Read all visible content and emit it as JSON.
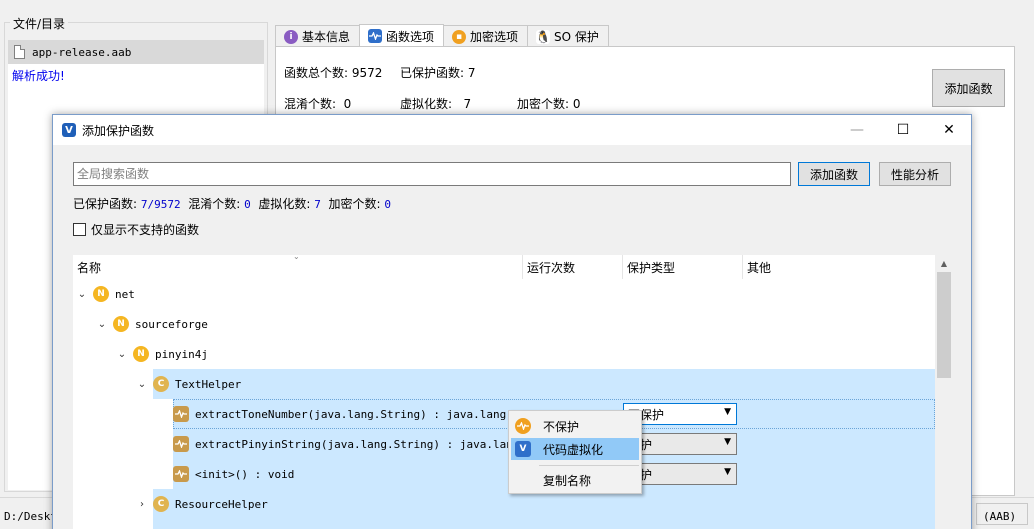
{
  "files": {
    "group_title": "文件/目录",
    "file_name": "app-release.aab",
    "parse_message": "解析成功!"
  },
  "tabs": [
    {
      "label": "基本信息",
      "icon": "info-icon"
    },
    {
      "label": "函数选项",
      "icon": "function-icon"
    },
    {
      "label": "加密选项",
      "icon": "lock-icon"
    },
    {
      "label": "SO 保护",
      "icon": "linux-icon"
    }
  ],
  "panel": {
    "total_label": "函数总个数: 9572",
    "protected_label": "已保护函数: 7",
    "obf_label": "混淆个数:  0",
    "virt_label": "虚拟化数:   7",
    "enc_label": "加密个数: 0",
    "add_button": "添加函数"
  },
  "status": {
    "left": "D:/Deskt",
    "right": "(AAB)"
  },
  "dialog": {
    "title": "添加保护函数",
    "search_placeholder": "全局搜索函数",
    "add_button": "添加函数",
    "perf_button": "性能分析",
    "stats": {
      "protected_label": "已保护函数: ",
      "protected_value": "7/9572",
      "obf_label": "  混淆个数: ",
      "obf_value": "0",
      "virt_label": "  虚拟化数: ",
      "virt_value": "7",
      "enc_label": "  加密个数: ",
      "enc_value": "0"
    },
    "only_unsupported": "仅显示不支持的函数",
    "columns": [
      "名称",
      "运行次数",
      "保护类型",
      "其他"
    ],
    "tree": [
      {
        "expander": "⌄",
        "icon": "N",
        "label": "net"
      },
      {
        "expander": "⌄",
        "icon": "N",
        "label": "sourceforge"
      },
      {
        "expander": "⌄",
        "icon": "N",
        "label": "pinyin4j"
      },
      {
        "expander": "⌄",
        "icon": "C",
        "label": "TextHelper"
      },
      {
        "expander": "",
        "icon": "M",
        "label": "extractToneNumber(java.lang.String) : java.lang.Stri",
        "combo": "不保护"
      },
      {
        "expander": "",
        "icon": "M",
        "label": "extractPinyinString(java.lang.String) : java.lang.St",
        "combo": "保护"
      },
      {
        "expander": "",
        "icon": "M",
        "label": "<init>() : void",
        "combo": "保护"
      },
      {
        "expander": "›",
        "icon": "C",
        "label": "ResourceHelper"
      }
    ],
    "context_menu": {
      "no_protect": "不保护",
      "virtualize": "代码虚拟化",
      "copy_name": "复制名称"
    }
  }
}
